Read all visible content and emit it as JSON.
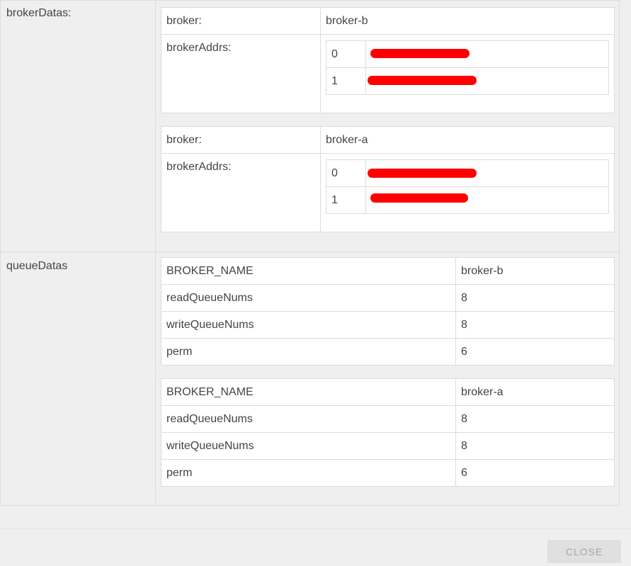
{
  "brokerDatas": {
    "label": "brokerDatas:",
    "items": [
      {
        "broker_key": "broker:",
        "broker_name": "broker-b",
        "addrs_key": "brokerAddrs:",
        "addrs": [
          {
            "index": "0"
          },
          {
            "index": "1"
          }
        ]
      },
      {
        "broker_key": "broker:",
        "broker_name": "broker-a",
        "addrs_key": "brokerAddrs:",
        "addrs": [
          {
            "index": "0"
          },
          {
            "index": "1"
          }
        ]
      }
    ]
  },
  "queueDatas": {
    "label": "queueDatas",
    "items": [
      {
        "rows": [
          {
            "key": "BROKER_NAME",
            "value": "broker-b"
          },
          {
            "key": "readQueueNums",
            "value": "8"
          },
          {
            "key": "writeQueueNums",
            "value": "8"
          },
          {
            "key": "perm",
            "value": "6"
          }
        ]
      },
      {
        "rows": [
          {
            "key": "BROKER_NAME",
            "value": "broker-a"
          },
          {
            "key": "readQueueNums",
            "value": "8"
          },
          {
            "key": "writeQueueNums",
            "value": "8"
          },
          {
            "key": "perm",
            "value": "6"
          }
        ]
      }
    ]
  },
  "footer": {
    "close_label": "CLOSE"
  },
  "colors": {
    "redaction": "#ff0000",
    "border": "#dcdcdc",
    "background": "#efefef"
  }
}
